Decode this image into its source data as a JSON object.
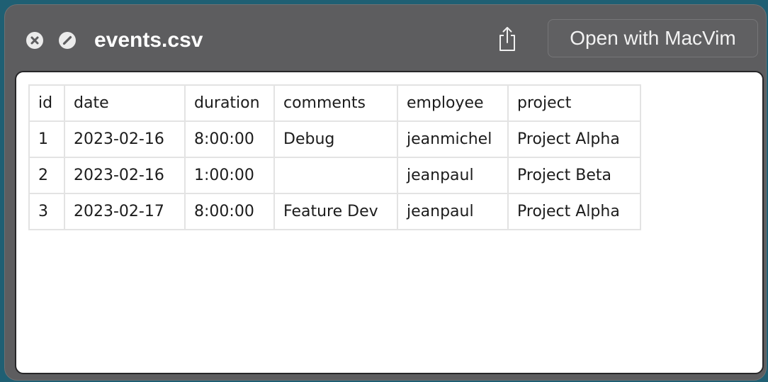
{
  "window": {
    "title": "events.csv",
    "open_with_label": "Open with MacVim",
    "icons": {
      "close": "close-icon",
      "fullscreen": "fullscreen-icon",
      "share": "share-icon"
    }
  },
  "table": {
    "headers": [
      "id",
      "date",
      "duration",
      "comments",
      "employee",
      "project"
    ],
    "rows": [
      [
        "1",
        "2023-02-16",
        "8:00:00",
        "Debug",
        "jeanmichel",
        "Project Alpha"
      ],
      [
        "2",
        "2023-02-16",
        "1:00:00",
        "",
        "jeanpaul",
        "Project Beta"
      ],
      [
        "3",
        "2023-02-17",
        "8:00:00",
        "Feature Dev",
        "jeanpaul",
        "Project Alpha"
      ]
    ]
  },
  "colors": {
    "desktop": "#1f5f73",
    "titlebar": "#5d5d5f",
    "content_bg": "#ffffff",
    "grid": "#e3e3e3"
  }
}
